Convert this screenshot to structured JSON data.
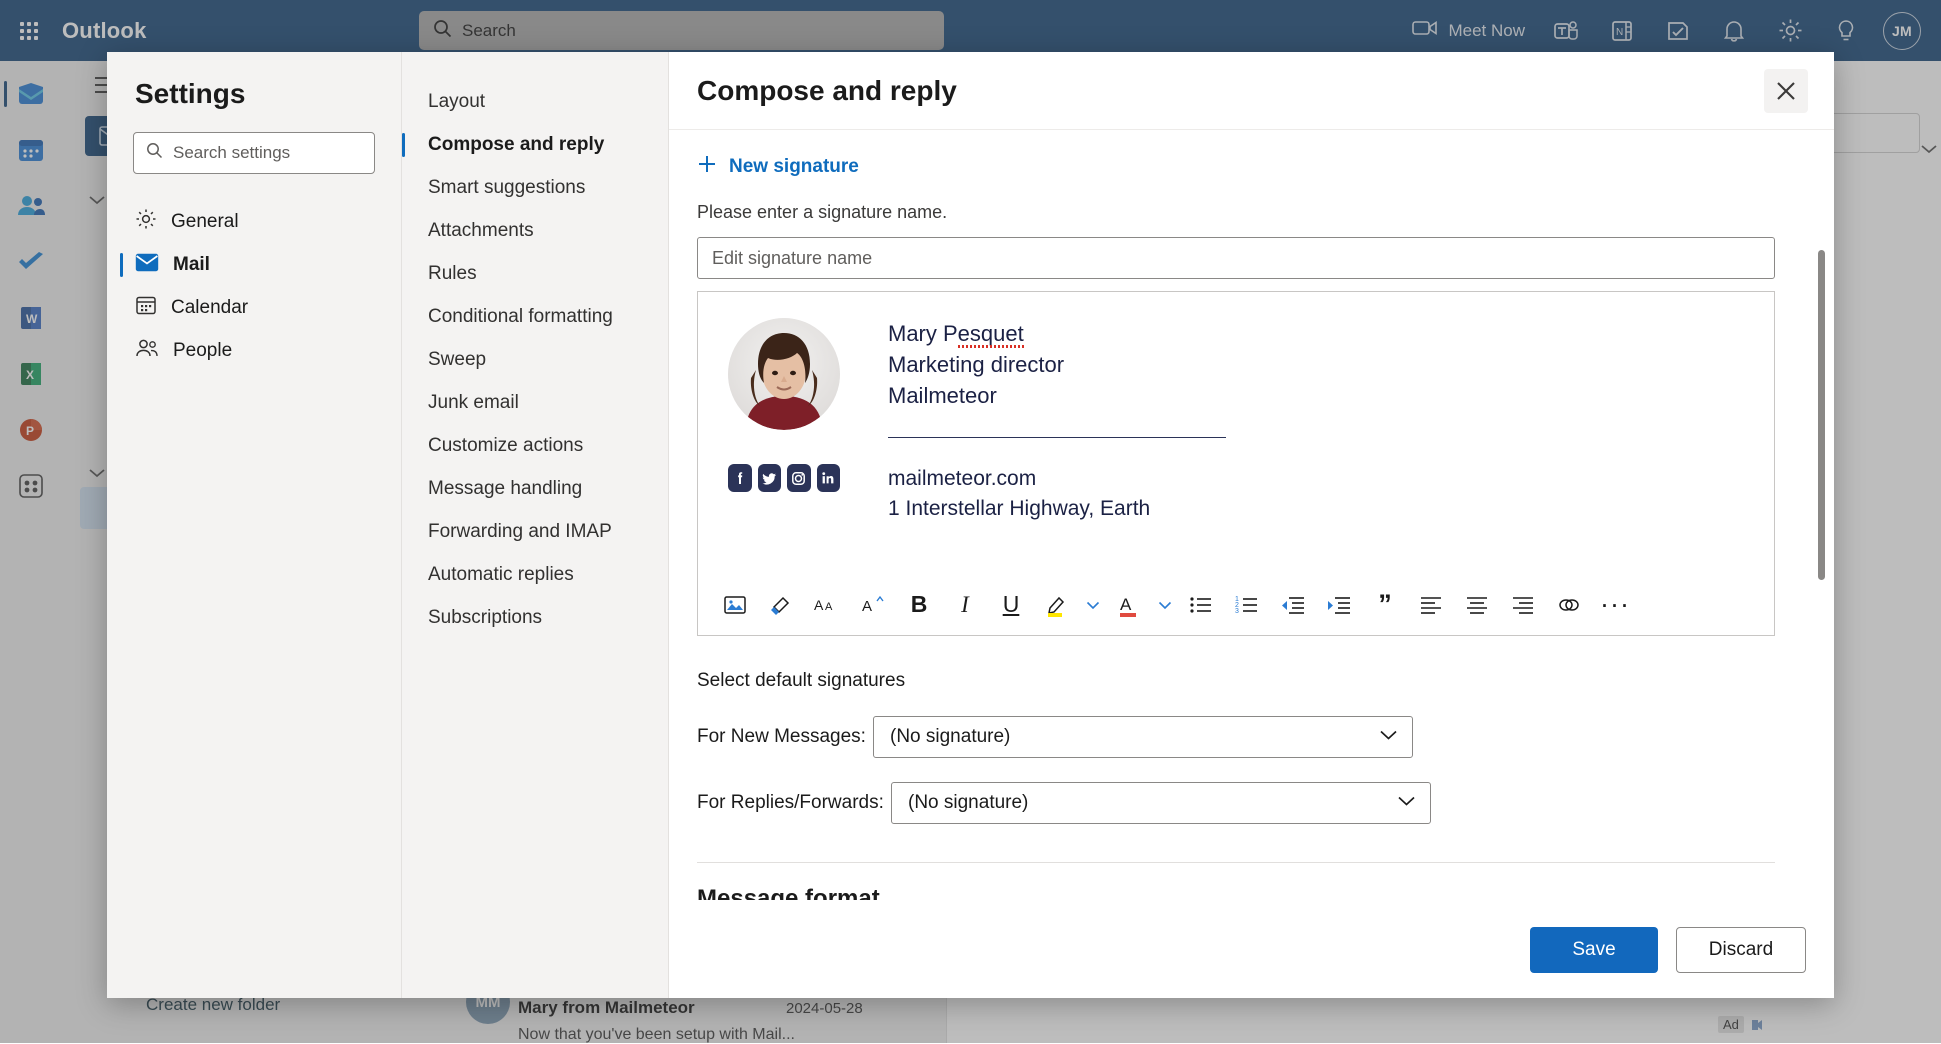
{
  "topbar": {
    "waffle_icon": "app-launcher-icon",
    "brand": "Outlook",
    "search_placeholder": "Search",
    "search_icon": "search-icon",
    "meet_now": "Meet Now",
    "icons": [
      "video-camera-icon",
      "teams-icon",
      "onenote-icon",
      "todo-icon",
      "bell-icon",
      "gear-icon",
      "lightbulb-icon"
    ],
    "avatar_initials": "JM"
  },
  "rail": {
    "items": [
      {
        "name": "mail",
        "label": "Mail"
      },
      {
        "name": "calendar",
        "label": "Calendar"
      },
      {
        "name": "people",
        "label": "People"
      },
      {
        "name": "todo",
        "label": "To Do"
      },
      {
        "name": "word",
        "label": "Word"
      },
      {
        "name": "excel",
        "label": "Excel"
      },
      {
        "name": "powerpoint",
        "label": "PowerPoint"
      },
      {
        "name": "apps",
        "label": "Apps"
      }
    ]
  },
  "background": {
    "create_new_folder": "Create new folder",
    "message": {
      "avatar_initials": "MM",
      "from": "Mary from Mailmeteor",
      "date": "2024-05-28",
      "preview": "Now that you've been setup with Mail..."
    },
    "ad_label": "Ad"
  },
  "settings": {
    "title": "Settings",
    "search_placeholder": "Search settings",
    "categories": [
      {
        "label": "General",
        "icon": "gear-icon",
        "active": false
      },
      {
        "label": "Mail",
        "icon": "mail-icon",
        "active": true
      },
      {
        "label": "Calendar",
        "icon": "calendar-icon",
        "active": false
      },
      {
        "label": "People",
        "icon": "people-icon",
        "active": false
      }
    ],
    "nav": [
      {
        "label": "Layout",
        "active": false
      },
      {
        "label": "Compose and reply",
        "active": true
      },
      {
        "label": "Smart suggestions",
        "active": false
      },
      {
        "label": "Attachments",
        "active": false
      },
      {
        "label": "Rules",
        "active": false
      },
      {
        "label": "Conditional formatting",
        "active": false
      },
      {
        "label": "Sweep",
        "active": false
      },
      {
        "label": "Junk email",
        "active": false
      },
      {
        "label": "Customize actions",
        "active": false
      },
      {
        "label": "Message handling",
        "active": false
      },
      {
        "label": "Forwarding and IMAP",
        "active": false
      },
      {
        "label": "Automatic replies",
        "active": false
      },
      {
        "label": "Subscriptions",
        "active": false
      }
    ],
    "panel": {
      "heading": "Compose and reply",
      "close_icon": "close-icon",
      "new_signature": "New signature",
      "new_signature_icon": "plus-icon",
      "hint": "Please enter a signature name.",
      "signature_name_placeholder": "Edit signature name",
      "signature_name_value": "",
      "signature": {
        "photo_alt": "portrait-photo",
        "name": "Mary Pesquet",
        "role": "Marketing director",
        "company": "Mailmeteor",
        "website": "mailmeteor.com",
        "address": "1 Interstellar Highway, Earth",
        "socials": [
          "facebook-icon",
          "twitter-icon",
          "instagram-icon",
          "linkedin-icon"
        ]
      },
      "toolbar": [
        "insert-picture-icon",
        "format-painter-icon",
        "font-family-icon",
        "font-size-icon",
        "bold-icon",
        "italic-icon",
        "underline-icon",
        "highlight-color-icon",
        "highlight-chevron-icon",
        "font-color-icon",
        "font-color-chevron-icon",
        "bulleted-list-icon",
        "numbered-list-icon",
        "decrease-indent-icon",
        "increase-indent-icon",
        "quote-icon",
        "align-left-icon",
        "align-center-icon",
        "align-right-icon",
        "insert-link-icon",
        "more-options-icon"
      ],
      "toolbar_glyphs": {
        "bold": "B",
        "italic": "I",
        "underline": "U",
        "quote": "”",
        "more": "···"
      },
      "select_default_label": "Select default signatures",
      "new_messages_label": "For New Messages:",
      "new_messages_value": "(No signature)",
      "replies_label": "For Replies/Forwards:",
      "replies_value": "(No signature)",
      "message_format_heading": "Message format"
    },
    "footer": {
      "save": "Save",
      "discard": "Discard"
    }
  },
  "colors": {
    "topbar_blue": "#1b4a79",
    "accent_blue": "#0f6cbd",
    "save_blue": "#1268bd",
    "signature_navy": "#1b2144"
  }
}
